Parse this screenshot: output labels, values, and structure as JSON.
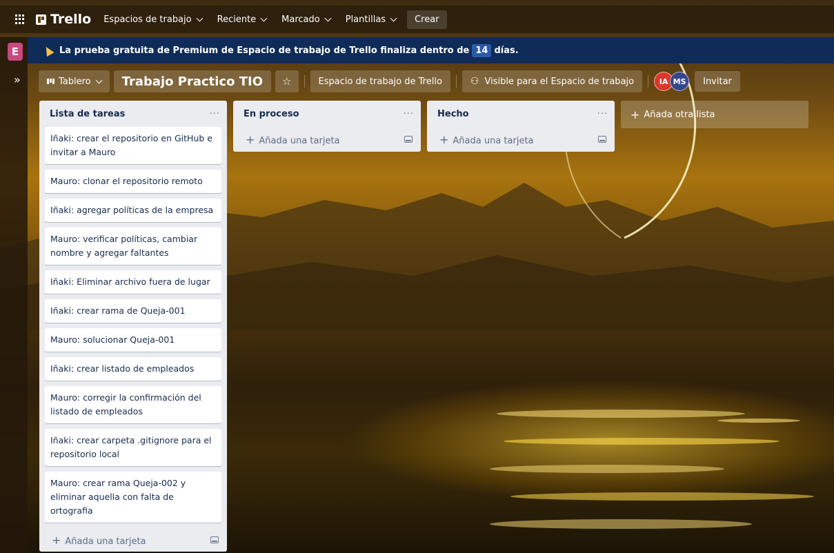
{
  "topnav": {
    "logo": "Trello",
    "items": [
      {
        "label": "Espacios de trabajo"
      },
      {
        "label": "Reciente"
      },
      {
        "label": "Marcado"
      },
      {
        "label": "Plantillas"
      }
    ],
    "create_label": "Crear"
  },
  "sidebar": {
    "workspace_initial": "E",
    "expand_icon": "double-chevron-right-icon"
  },
  "banner": {
    "text_before": "La prueba gratuita de Premium de Espacio de trabajo de Trello finaliza dentro de",
    "days": "14",
    "text_after": "días."
  },
  "board_header": {
    "view_label": "Tablero",
    "title": "Trabajo Practico TIO",
    "workspace_label": "Espacio de trabajo de Trello",
    "visibility_label": "Visible para el Espacio de trabajo",
    "members": [
      "IA",
      "MS"
    ],
    "invite_label": "Invitar"
  },
  "lists": [
    {
      "title": "Lista de tareas",
      "cards": [
        "Iñaki: crear el repositorio en GitHub e invitar a Mauro",
        "Mauro: clonar el repositorio remoto",
        "Iñaki: agregar políticas de la empresa",
        "Mauro: verificar políticas, cambiar nombre y agregar faltantes",
        "Iñaki: Eliminar archivo fuera de lugar",
        "Iñaki: crear rama de Queja-001",
        "Mauro: solucionar Queja-001",
        "Iñaki: crear listado de empleados",
        "Mauro: corregir la confirmación del listado de empleados",
        "Iñaki: crear carpeta .gitignore para el repositorio local",
        "Mauro: crear rama Queja-002 y eliminar aquella con falta de ortografia"
      ]
    },
    {
      "title": "En proceso",
      "cards": []
    },
    {
      "title": "Hecho",
      "cards": []
    }
  ],
  "add_card_label": "Añada una tarjeta",
  "add_list_label": "Añada otra lista",
  "colors": {
    "banner": "#0f2b57",
    "workspace_avatar": "#c8497f",
    "member_ia": "#d9382a",
    "member_ms": "#36468c"
  }
}
